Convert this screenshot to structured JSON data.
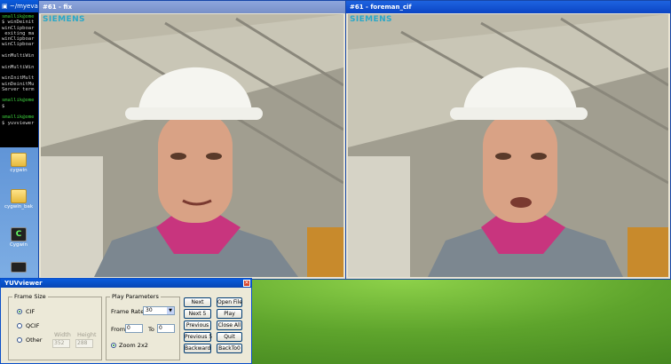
{
  "terminal": {
    "title": "~/myeval",
    "lines": [
      {
        "text": "smallik@ome",
        "color": "green"
      },
      {
        "text": "$ winDeinit",
        "color": "gray"
      },
      {
        "text": "winClipboar",
        "color": "gray"
      },
      {
        "text": " exiting ma",
        "color": "gray"
      },
      {
        "text": "winClipboar",
        "color": "gray"
      },
      {
        "text": "winClipboar",
        "color": "gray"
      },
      {
        "text": "",
        "color": "gray"
      },
      {
        "text": "winMultiWin",
        "color": "gray"
      },
      {
        "text": "",
        "color": "gray"
      },
      {
        "text": "winMultiWin",
        "color": "gray"
      },
      {
        "text": "",
        "color": "gray"
      },
      {
        "text": "winInitMult",
        "color": "gray"
      },
      {
        "text": "winDeinitMu",
        "color": "gray"
      },
      {
        "text": "Server term",
        "color": "gray"
      },
      {
        "text": "",
        "color": "gray"
      },
      {
        "text": "smallik@ome",
        "color": "green"
      },
      {
        "text": "$",
        "color": "gray"
      },
      {
        "text": "",
        "color": "gray"
      },
      {
        "text": "smallik@ome",
        "color": "green"
      },
      {
        "text": "$ yuvviewer",
        "color": "gray"
      }
    ]
  },
  "desktop_icons": [
    {
      "label": "cygwin",
      "icon": "folder-icon"
    },
    {
      "label": "cygwin_bak",
      "icon": "folder-icon"
    },
    {
      "label": "Cygwin",
      "icon": "cygwin-icon"
    }
  ],
  "video_windows": [
    {
      "title": "#61 - fix",
      "logo": "SIEMENS",
      "state": "inactive"
    },
    {
      "title": "#61 - foreman_cif",
      "logo": "SIEMENS",
      "state": "active"
    }
  ],
  "yuv_viewer": {
    "title": "YUVviewer",
    "frame_size": {
      "legend": "Frame Size",
      "options": [
        "CIF",
        "QCIF",
        "Other"
      ],
      "selected": "CIF",
      "width_label": "Width",
      "height_label": "Height",
      "width_value": "352",
      "height_value": "288"
    },
    "play_parameters": {
      "legend": "Play Parameters",
      "frame_rate_label": "Frame Rate",
      "frame_rate_value": "30",
      "from_label": "From",
      "from_value": "0",
      "to_label": "To",
      "to_value": "0",
      "zoom_label": "Zoom 2x2"
    },
    "nav_buttons": [
      "Next",
      "Next 5",
      "Previous",
      "Previous 5",
      "Backward"
    ],
    "file_buttons": [
      "Open File",
      "Play",
      "Close All",
      "Quit",
      "BackTo0"
    ]
  },
  "colors": {
    "title_active": "#0b45c4",
    "title_inactive": "#7890c8",
    "siemens_logo": "#2aa8c8",
    "panel_bg": "#ece9d8"
  }
}
